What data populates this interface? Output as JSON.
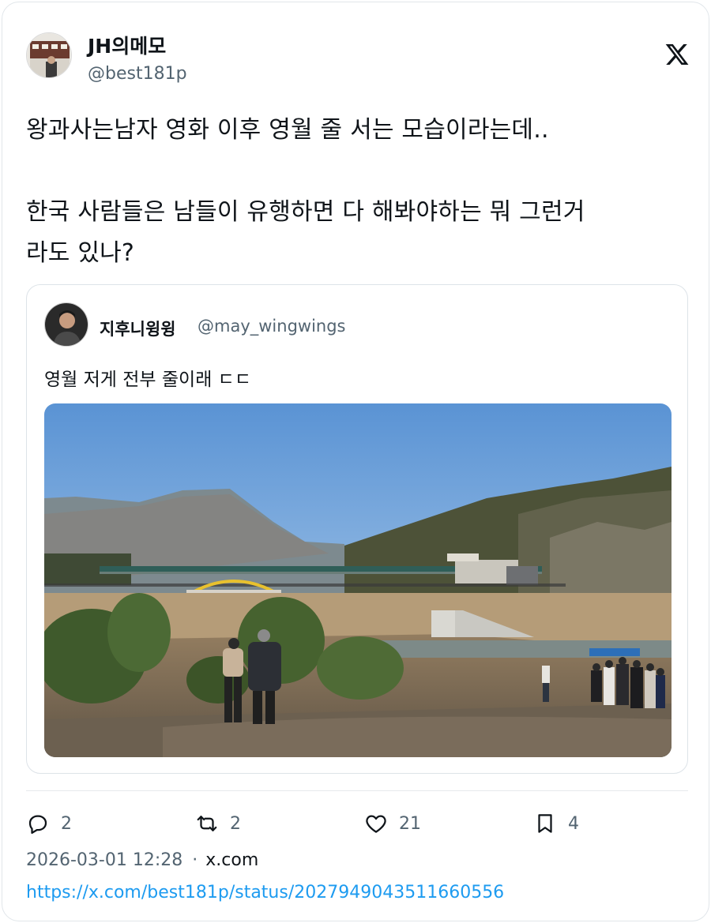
{
  "post": {
    "author": {
      "display_name": "JH의메모",
      "handle": "@best181p"
    },
    "text": "왕과사는남자 영화 이후 영월 줄 서는 모습이라는데..\n\n한국 사람들은 남들이 유행하면 다 해봐야하는 뭐 그런거\n라도 있나?",
    "quote": {
      "author": {
        "display_name": "지후니윙윙",
        "handle": "@may_wingwings"
      },
      "text": "영월 저게 전부 줄이래 ㄷㄷ"
    },
    "actions": {
      "replies": "2",
      "reposts": "2",
      "likes": "21",
      "bookmarks": "4"
    },
    "timestamp": "2026-03-01 12:28",
    "separator": "·",
    "source": "x.com",
    "url": "https://x.com/best181p/status/2027949043511660556"
  },
  "icons": {
    "platform": "x-logo-icon",
    "reply": "reply-icon",
    "repost": "repost-icon",
    "like": "heart-icon",
    "bookmark": "bookmark-icon"
  },
  "colors": {
    "text": "#0f1419",
    "secondary": "#536471",
    "link": "#1d9bf0",
    "border": "#e1e6ea"
  }
}
